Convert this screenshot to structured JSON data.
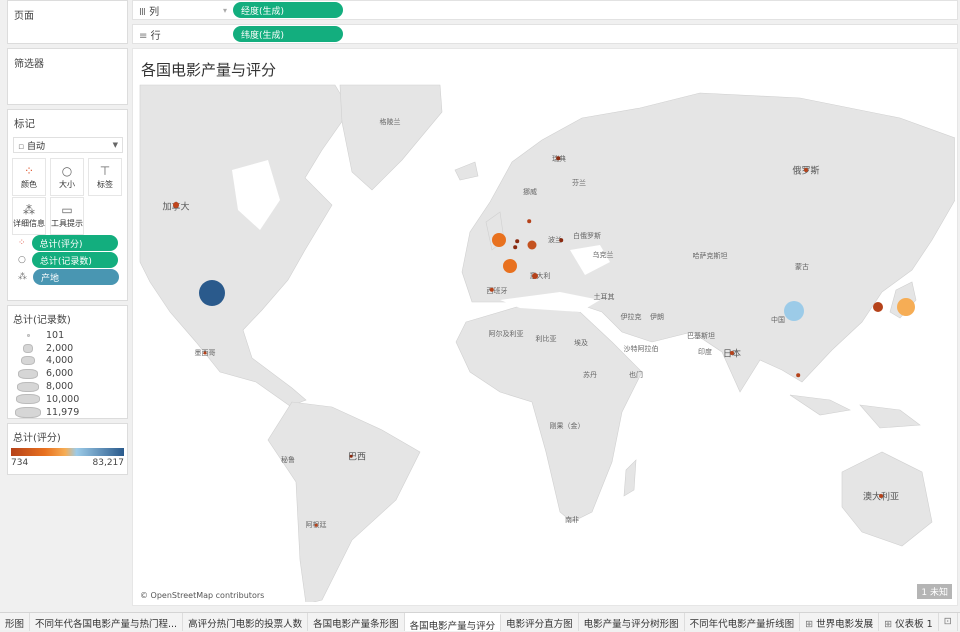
{
  "pages_card": {
    "title": "页面"
  },
  "filters_card": {
    "title": "筛选器"
  },
  "shelves": {
    "columns": {
      "label": "列",
      "pill": "经度(生成)"
    },
    "rows": {
      "label": "行",
      "pill": "纬度(生成)"
    }
  },
  "marks_card": {
    "title": "标记",
    "mark_type": "自动",
    "buttons": [
      "颜色",
      "大小",
      "标签",
      "详细信息",
      "工具提示"
    ],
    "pills": [
      "总计(评分)",
      "总计(记录数)",
      "产地"
    ]
  },
  "size_legend": {
    "title": "总计(记录数)",
    "items": [
      "101",
      "2,000",
      "4,000",
      "6,000",
      "8,000",
      "10,000",
      "11,979"
    ]
  },
  "color_legend": {
    "title": "总计(评分)",
    "min": "734",
    "max": "83,217",
    "colors": {
      "low": "#b5421a",
      "mid": "#f6ad55",
      "mid2": "#9ccbe8",
      "high": "#2a5a8c"
    }
  },
  "view": {
    "title": "各国电影产量与评分",
    "attribution": "© OpenStreetMap contributors",
    "unknown_badge": "1 未知"
  },
  "map_labels": [
    "格陵兰",
    "加拿大",
    "俄罗斯",
    "哈萨克斯坦",
    "蒙古",
    "日本",
    "中国",
    "印度",
    "巴基斯坦",
    "伊朗",
    "伊拉克",
    "沙特阿拉伯",
    "土耳其",
    "乌克兰",
    "白俄罗斯",
    "挪威",
    "瑞典",
    "芬兰",
    "西班牙",
    "意大利",
    "阿尔及利亚",
    "利比亚",
    "埃及",
    "苏丹",
    "也门",
    "刚果（金）",
    "南非",
    "巴西",
    "秘鲁",
    "阿根廷",
    "墨西哥",
    "澳大利亚",
    "波兰"
  ],
  "tabs": [
    "形图",
    "不同年代各国电影产量与热门程...",
    "高评分热门电影的投票人数",
    "各国电影产量条形图",
    "各国电影产量与评分",
    "电影评分直方图",
    "电影产量与评分树形图",
    "不同年代电影产量折线图",
    "世界电影发展",
    "仪表板 1"
  ],
  "active_tab": "各国电影产量与评分"
}
